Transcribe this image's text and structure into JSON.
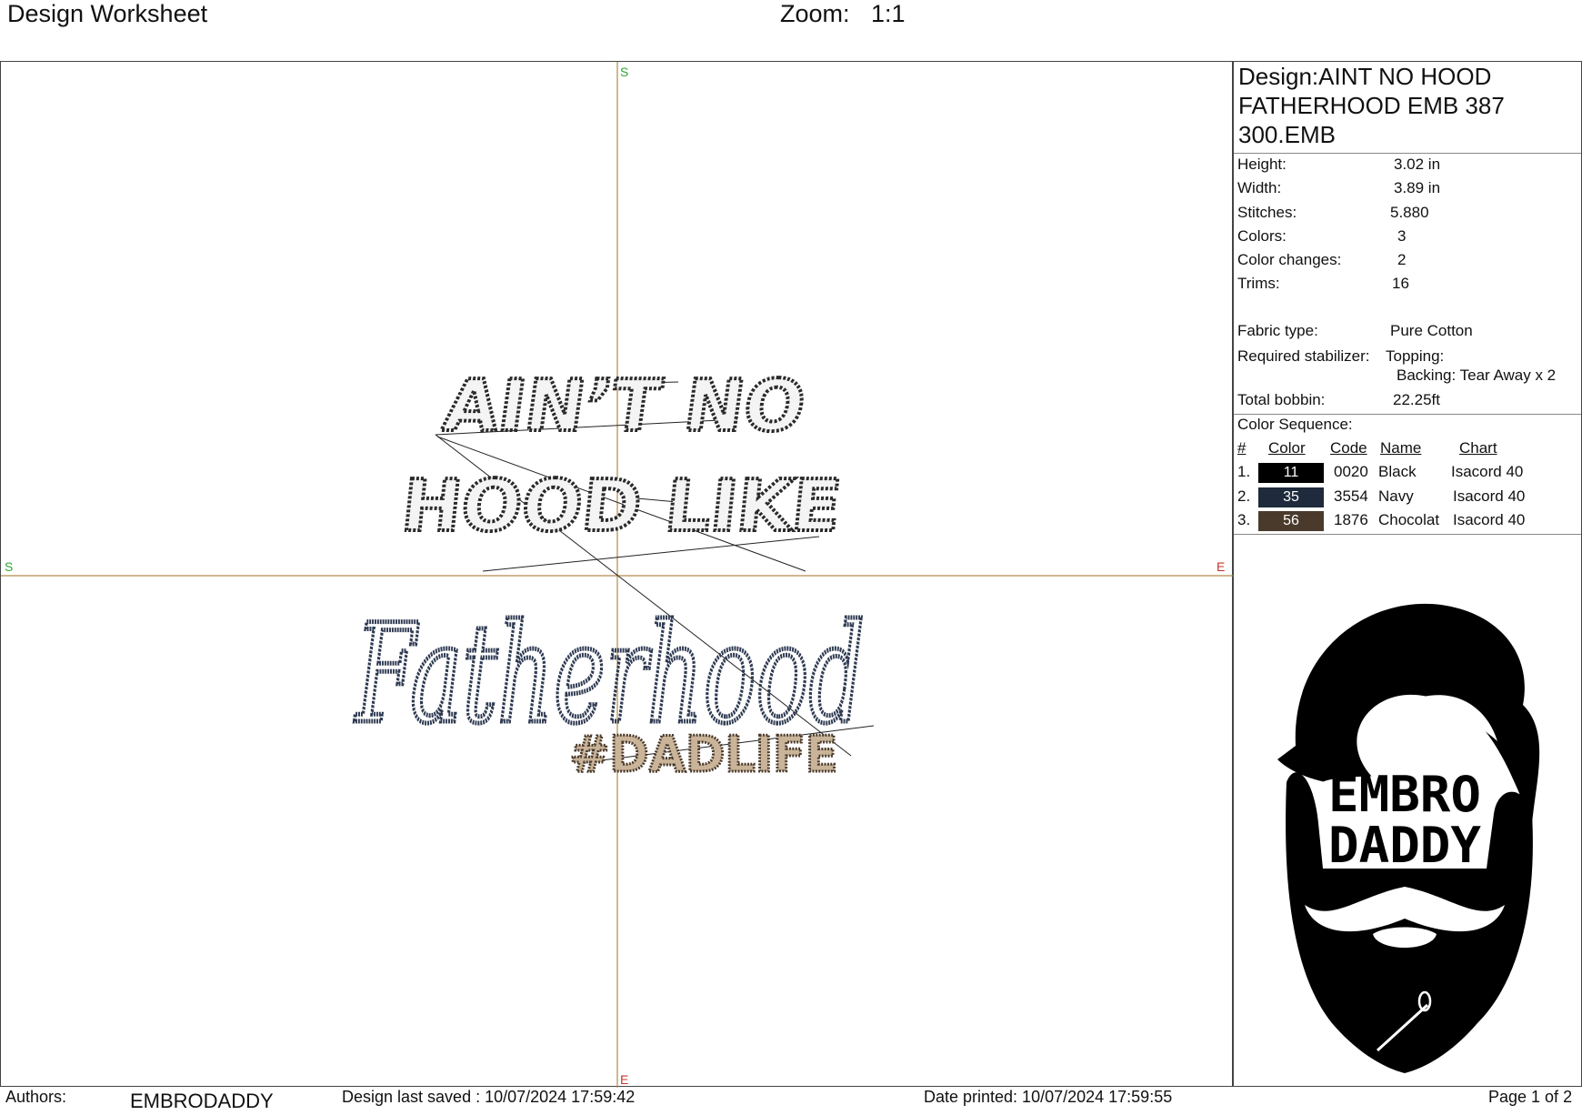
{
  "header": {
    "title": "Design Worksheet",
    "zoom_label": "Zoom:",
    "zoom_value": "1:1"
  },
  "canvas": {
    "axis_start_label": "S",
    "axis_end_label": "E",
    "design_text": {
      "line1": "AIN’T NO",
      "line2": "HOOD LIKE",
      "line3": "Fatherhood",
      "line4": "#DADLIFE"
    }
  },
  "panel": {
    "design_name": "Design:AINT NO HOOD FATHERHOOD EMB 387 300.EMB",
    "properties": [
      {
        "label": "Height:",
        "value": "3.02 in"
      },
      {
        "label": "Width:",
        "value": "3.89 in"
      },
      {
        "label": "Stitches:",
        "value": "5.880"
      },
      {
        "label": "Colors:",
        "value": "3"
      },
      {
        "label": "Color changes:",
        "value": "2"
      },
      {
        "label": "Trims:",
        "value": "16"
      }
    ],
    "fabric_label": "Fabric type:",
    "fabric_value": "Pure Cotton",
    "stabilizer_label": "Required stabilizer:",
    "stabilizer_topping": "Topping:",
    "stabilizer_backing": "Backing: Tear Away x 2",
    "bobbin_label": "Total bobbin:",
    "bobbin_value": "22.25ft",
    "sequence_title": "Color Sequence:",
    "sequence_headers": {
      "num": "#",
      "color": "Color",
      "code": "Code",
      "name": "Name",
      "chart": "Chart"
    },
    "sequence": [
      {
        "num": "1.",
        "swatch": "11",
        "color": "#000000",
        "code": "0020",
        "name": "Black",
        "chart": "Isacord 40"
      },
      {
        "num": "2.",
        "swatch": "35",
        "color": "#1f2a3c",
        "code": "3554",
        "name": "Navy",
        "chart": "Isacord 40"
      },
      {
        "num": "3.",
        "swatch": "56",
        "color": "#4a3a2c",
        "code": "1876",
        "name": "Chocolat",
        "chart": "Isacord 40"
      }
    ],
    "logo": {
      "line1": "EMBRO",
      "line2": "DADDY"
    }
  },
  "footer": {
    "authors_label": "Authors:",
    "authors_value": "EMBRODADDY",
    "saved": "Design last saved : 10/07/2024 17:59:42",
    "printed": "Date printed: 10/07/2024 17:59:55",
    "page": "Page 1 of 2"
  },
  "colors": {
    "axis": "#b58a4a",
    "axis_start": "#2ea82e",
    "axis_end": "#c0392b"
  }
}
